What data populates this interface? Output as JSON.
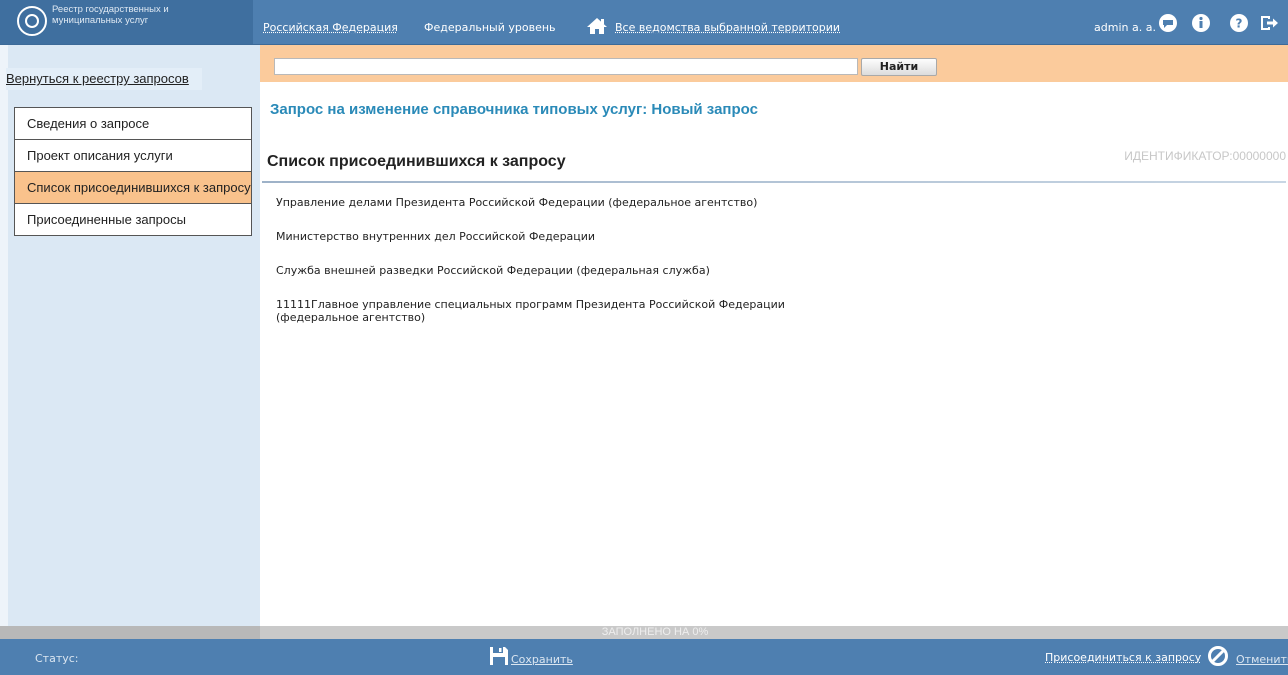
{
  "header": {
    "logo_text": "Реестр государственных и муниципальных услуг",
    "territory": "Российская Федерация",
    "level": "Федеральный уровень",
    "departments": "Все ведомства выбранной территории",
    "user": "admin a. a.",
    "icons": [
      "home-icon",
      "chat-icon",
      "info-icon",
      "help-icon",
      "logout-icon"
    ]
  },
  "sidebar": {
    "back_link": "Вернуться к реестру запросов",
    "items": [
      {
        "label": "Сведения о запросе",
        "active": false
      },
      {
        "label": "Проект описания услуги",
        "active": false
      },
      {
        "label": "Список присоединившихся к запросу",
        "active": true
      },
      {
        "label": "Присоединенные запросы",
        "active": false
      }
    ]
  },
  "search": {
    "value": "",
    "button_label": "Найти"
  },
  "main": {
    "page_title": "Запрос на изменение справочника типовых услуг: Новый запрос",
    "section_title": "Список присоединившихся к запросу",
    "identifier": "ИДЕНТИФИКАТОР:00000000",
    "organizations": [
      "Управление делами Президента Российской Федерации (федеральное агентство)",
      "Министерство внутренних дел Российской Федерации",
      "Служба внешней разведки Российской Федерации (федеральная служба)",
      "11111Главное управление специальных программ Президента Российской Федерации (федеральное агентство)"
    ]
  },
  "progress": {
    "label": "ЗАПОЛНЕНО НА 0%",
    "percent": 0
  },
  "footer": {
    "status_label": "Статус:",
    "save_label": "Сохранить",
    "join_label": "Присоединиться к запросу",
    "cancel_label": "Отменить"
  },
  "colors": {
    "header_bg": "#4e7fb0",
    "accent_orange": "#fbcb9c",
    "title_blue": "#2a8ab8"
  }
}
